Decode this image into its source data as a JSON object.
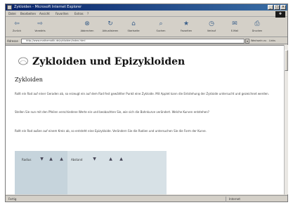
{
  "window": {
    "title": "Zykloiden - Microsoft Internet Explorer",
    "minimize": "_",
    "maximize": "□",
    "close": "×"
  },
  "menu": [
    "Datei",
    "Bearbeiten",
    "Ansicht",
    "Favoriten",
    "Extras",
    "?"
  ],
  "toolbar": [
    {
      "label": "Zurück",
      "icon": "back-arrow-icon",
      "glyph": "⇦"
    },
    {
      "label": "Vorwärts",
      "icon": "forward-arrow-icon",
      "glyph": "⇨"
    },
    {
      "label": "Abbrechen",
      "icon": "stop-icon",
      "glyph": "⊗"
    },
    {
      "label": "Aktualisieren",
      "icon": "refresh-icon",
      "glyph": "↻"
    },
    {
      "label": "Startseite",
      "icon": "home-icon",
      "glyph": "⌂"
    },
    {
      "label": "Suchen",
      "icon": "search-icon",
      "glyph": "⌕"
    },
    {
      "label": "Favoriten",
      "icon": "favorites-icon",
      "glyph": "★"
    },
    {
      "label": "Verlauf",
      "icon": "history-icon",
      "glyph": "◷"
    },
    {
      "label": "E-Mail",
      "icon": "mail-icon",
      "glyph": "✉"
    },
    {
      "label": "Drucken",
      "icon": "print-icon",
      "glyph": "⎙"
    }
  ],
  "address": {
    "label": "Adresse",
    "value": "http://www.mathematik.de/zykloiden/index.html",
    "go": "Wechseln zu",
    "links": "Links"
  },
  "page": {
    "title": "Zykloiden und Epizykloiden",
    "section": "Zykloiden",
    "paragraphs": [
      "Rollt ein Rad auf einer Geraden ab, so erzeugt ein auf dem Rad fest gewählter Punkt eine Zykloide. Mit Applet kann die Entstehung der Zykloide untersucht und gezeichnet werden.",
      "Stellen Sie nun mit den Pfeilen verschiedene Werte ein und beobachten Sie, wie sich die Bahnkurve verändert. Welche Kurven entstehen?",
      "Rollt ein Rad außen auf einem Kreis ab, so entsteht eine Epizykloide. Verändern Sie die Radien und untersuchen Sie die Form der Kurve."
    ],
    "applet": {
      "label1": "Radius",
      "label2": "Abstand",
      "spin_up": "▲",
      "spin_down": "▼"
    }
  },
  "status": {
    "text": "Fertig",
    "zone": "Internet"
  },
  "colors": {
    "titlebar": "#0a246a",
    "applet_bg": "#c6d4dc"
  }
}
